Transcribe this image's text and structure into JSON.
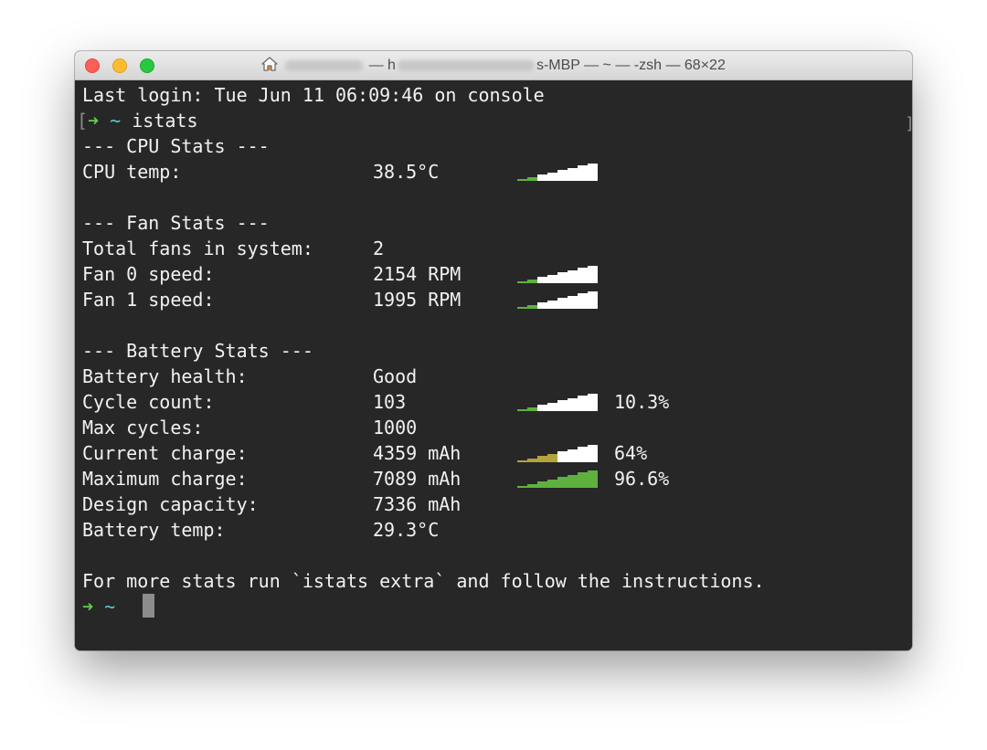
{
  "window": {
    "title_prefix": "h",
    "title_suffix": "s-MBP — ~ — -zsh — 68×22"
  },
  "terminal": {
    "last_login": "Last login: Tue Jun 11 06:09:46 on console",
    "prompt_arrow": "➜",
    "prompt_tilde": "~",
    "command": "istats",
    "cpu_header": "--- CPU Stats ---",
    "cpu_temp_label": "CPU temp:",
    "cpu_temp_value": "38.5°C",
    "fan_header": "--- Fan Stats ---",
    "fans_label": "Total fans in system:",
    "fans_value": "2",
    "fan0_label": "Fan 0 speed:",
    "fan0_value": "2154 RPM",
    "fan1_label": "Fan 1 speed:",
    "fan1_value": "1995 RPM",
    "battery_header": "--- Battery Stats ---",
    "health_label": "Battery health:",
    "health_value": "Good",
    "cycle_label": "Cycle count:",
    "cycle_value": "103",
    "cycle_pct": "10.3%",
    "maxcycles_label": "Max cycles:",
    "maxcycles_value": "1000",
    "current_label": "Current charge:",
    "current_value": "4359 mAh",
    "current_pct": "64%",
    "maxcharge_label": "Maximum charge:",
    "maxcharge_value": "7089 mAh",
    "maxcharge_pct": "96.6%",
    "design_label": "Design capacity:",
    "design_value": "7336 mAh",
    "battemp_label": "Battery temp:",
    "battemp_value": "29.3°C",
    "footer": "For more stats run `istats extra` and follow the instructions."
  },
  "sparklines": {
    "cpu_temp": {
      "level": 0.25,
      "color": "#5fb13f"
    },
    "fan0": {
      "level": 0.25,
      "color": "#5fb13f"
    },
    "fan1": {
      "level": 0.25,
      "color": "#5fb13f"
    },
    "cycle": {
      "level": 0.25,
      "color": "#5fb13f"
    },
    "current": {
      "level": 0.5,
      "color": "#b3a33c"
    },
    "maxcharge": {
      "level": 1.0,
      "color": "#5fb13f"
    }
  },
  "colors": {
    "background": "#272727",
    "text": "#f2f2f2",
    "prompt_arrow": "#5fd04a",
    "prompt_tilde": "#5bc8d6"
  }
}
